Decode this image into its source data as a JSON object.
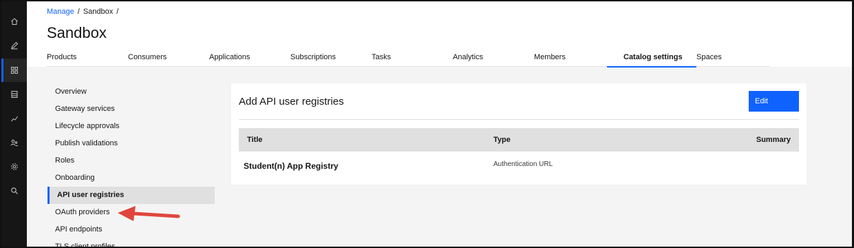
{
  "breadcrumb": {
    "root": "Manage",
    "current": "Sandbox",
    "sep": "/"
  },
  "page_title": "Sandbox",
  "tabs": [
    {
      "label": "Products"
    },
    {
      "label": "Consumers"
    },
    {
      "label": "Applications"
    },
    {
      "label": "Subscriptions"
    },
    {
      "label": "Tasks"
    },
    {
      "label": "Analytics"
    },
    {
      "label": "Members"
    },
    {
      "label": "Catalog settings"
    },
    {
      "label": "Spaces"
    }
  ],
  "active_tab": "Catalog settings",
  "sidenav": {
    "items": [
      {
        "label": "Overview"
      },
      {
        "label": "Gateway services"
      },
      {
        "label": "Lifecycle approvals"
      },
      {
        "label": "Publish validations"
      },
      {
        "label": "Roles"
      },
      {
        "label": "Onboarding"
      },
      {
        "label": "API user registries"
      },
      {
        "label": "OAuth providers"
      },
      {
        "label": "API endpoints"
      },
      {
        "label": "TLS client profiles"
      }
    ],
    "active": "API user registries"
  },
  "card": {
    "title": "Add API user registries",
    "edit_label": "Edit",
    "table": {
      "headers": {
        "title": "Title",
        "type": "Type",
        "summary": "Summary"
      },
      "rows": [
        {
          "title": "Student(n) App Registry",
          "type": "Authentication URL",
          "summary": ""
        }
      ]
    }
  },
  "rail_icons": [
    "home-icon",
    "edit-icon",
    "dashboard-icon",
    "catalog-icon",
    "analytics-icon",
    "members-icon",
    "settings-icon",
    "search-icon"
  ],
  "colors": {
    "accent": "#0f62fe",
    "rail": "#161616",
    "annotation_arrow": "#e0463d"
  }
}
